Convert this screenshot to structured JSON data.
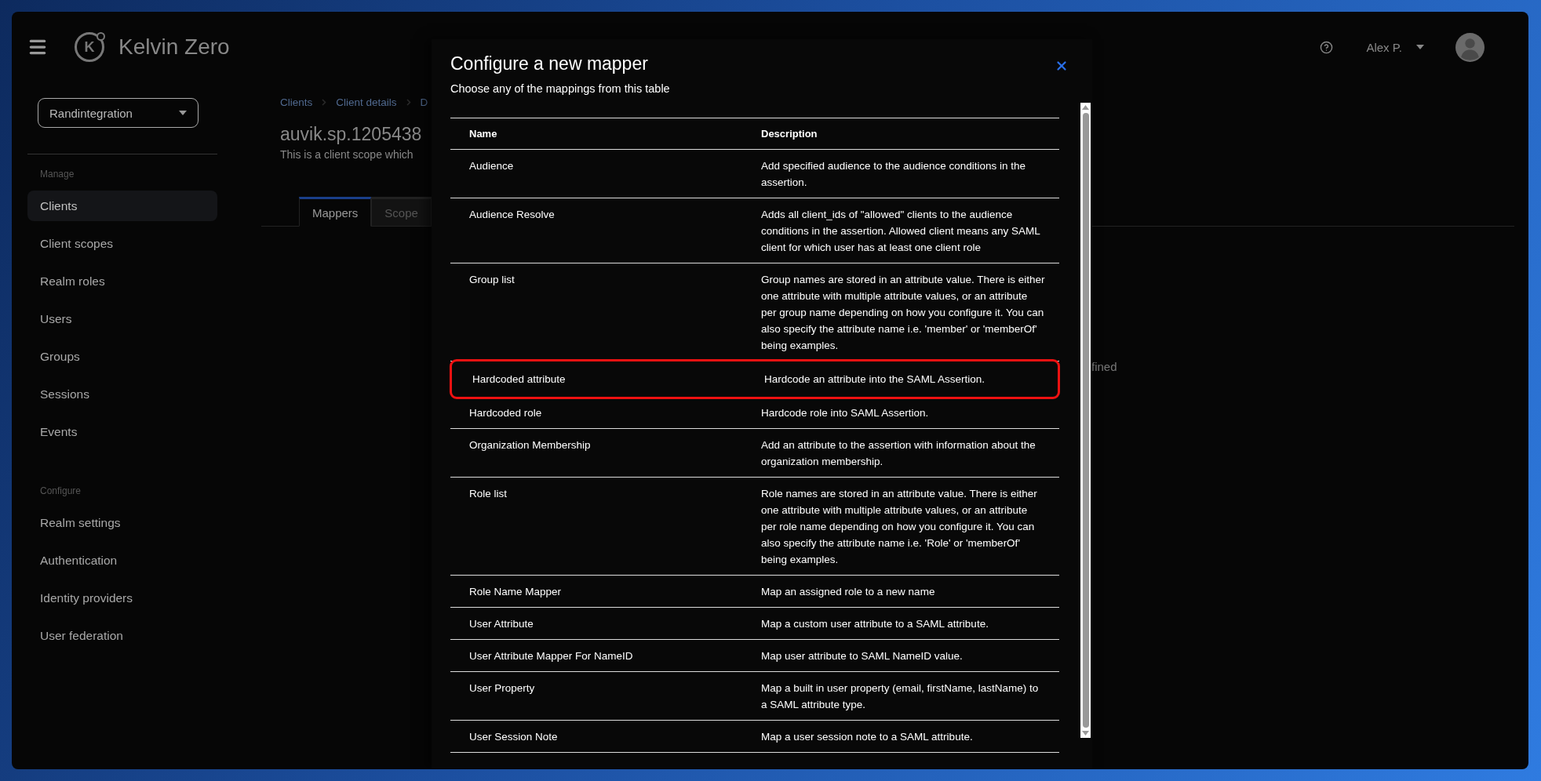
{
  "brand": {
    "mark": "K",
    "name": "Kelvin Zero"
  },
  "header": {
    "user": "Alex P."
  },
  "sidebar": {
    "realm": "Randintegration",
    "sections": [
      {
        "label": "Manage",
        "items": [
          {
            "label": "Clients",
            "selected": true
          },
          {
            "label": "Client scopes",
            "selected": false
          },
          {
            "label": "Realm roles",
            "selected": false
          },
          {
            "label": "Users",
            "selected": false
          },
          {
            "label": "Groups",
            "selected": false
          },
          {
            "label": "Sessions",
            "selected": false
          },
          {
            "label": "Events",
            "selected": false
          }
        ]
      },
      {
        "label": "Configure",
        "items": [
          {
            "label": "Realm settings",
            "selected": false
          },
          {
            "label": "Authentication",
            "selected": false
          },
          {
            "label": "Identity providers",
            "selected": false
          },
          {
            "label": "User federation",
            "selected": false
          }
        ]
      }
    ]
  },
  "breadcrumb": [
    "Clients",
    "Client details",
    "D"
  ],
  "page": {
    "title": "auvik.sp.1205438",
    "subtitle": "This is a client scope which",
    "empty_text": "fined"
  },
  "tabs": [
    {
      "label": "Mappers",
      "selected": true
    },
    {
      "label": "Scope",
      "selected": false
    }
  ],
  "modal": {
    "title": "Configure a new mapper",
    "subtitle": "Choose any of the mappings from this table",
    "columns": [
      "Name",
      "Description"
    ],
    "rows": [
      {
        "name": "Audience",
        "description": "Add specified audience to the audience conditions in the assertion.",
        "highlighted": false
      },
      {
        "name": "Audience Resolve",
        "description": "Adds all client_ids of \"allowed\" clients to the audience conditions in the assertion. Allowed client means any SAML client for which user has at least one client role",
        "highlighted": false
      },
      {
        "name": "Group list",
        "description": "Group names are stored in an attribute value. There is either one attribute with multiple attribute values, or an attribute per group name depending on how you configure it. You can also specify the attribute name i.e. 'member' or 'memberOf' being examples.",
        "highlighted": false
      },
      {
        "name": "Hardcoded attribute",
        "description": "Hardcode an attribute into the SAML Assertion.",
        "highlighted": true
      },
      {
        "name": "Hardcoded role",
        "description": "Hardcode role into SAML Assertion.",
        "highlighted": false
      },
      {
        "name": "Organization Membership",
        "description": "Add an attribute to the assertion with information about the organization membership.",
        "highlighted": false
      },
      {
        "name": "Role list",
        "description": "Role names are stored in an attribute value. There is either one attribute with multiple attribute values, or an attribute per role name depending on how you configure it. You can also specify the attribute name i.e. 'Role' or 'memberOf' being examples.",
        "highlighted": false
      },
      {
        "name": "Role Name Mapper",
        "description": "Map an assigned role to a new name",
        "highlighted": false
      },
      {
        "name": "User Attribute",
        "description": "Map a custom user attribute to a SAML attribute.",
        "highlighted": false
      },
      {
        "name": "User Attribute Mapper For NameID",
        "description": "Map user attribute to SAML NameID value.",
        "highlighted": false
      },
      {
        "name": "User Property",
        "description": "Map a built in user property (email, firstName, lastName) to a SAML attribute type.",
        "highlighted": false
      },
      {
        "name": "User Session Note",
        "description": "Map a user session note to a SAML attribute.",
        "highlighted": false
      }
    ]
  }
}
